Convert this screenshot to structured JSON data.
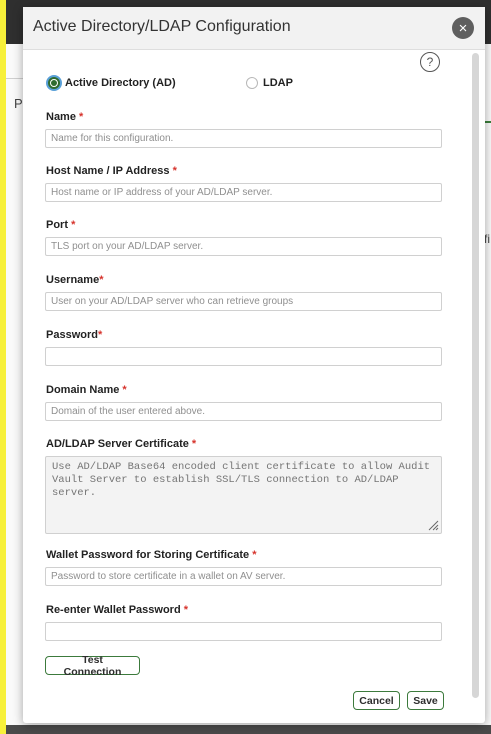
{
  "backdrop": {
    "left_letter": "P",
    "right_letters": "fi"
  },
  "dialog": {
    "title": "Active Directory/LDAP Configuration",
    "close_icon": "×",
    "help_icon": "?",
    "radios": [
      {
        "label": "Active Directory (AD)",
        "checked": true
      },
      {
        "label": "LDAP",
        "checked": false
      }
    ],
    "required_mark": "*",
    "fields": {
      "name": {
        "label": "Name",
        "placeholder": "Name for this configuration."
      },
      "host": {
        "label": "Host Name / IP Address",
        "placeholder": "Host name or IP address of your AD/LDAP server."
      },
      "port": {
        "label": "Port",
        "placeholder": "TLS port on your AD/LDAP server."
      },
      "username": {
        "label": "Username",
        "placeholder": "User on your AD/LDAP server who can retrieve groups"
      },
      "password": {
        "label": "Password",
        "placeholder": ""
      },
      "domain": {
        "label": "Domain Name",
        "placeholder": "Domain of the user entered above."
      },
      "certificate": {
        "label": "AD/LDAP Server Certificate",
        "placeholder": "Use AD/LDAP Base64 encoded client certificate to allow Audit Vault Server to establish SSL/TLS connection to AD/LDAP server."
      },
      "wallet_password": {
        "label": "Wallet Password for Storing Certificate",
        "placeholder": "Password to store certificate in a wallet on AV server."
      },
      "wallet_reenter": {
        "label": "Re-enter Wallet Password",
        "placeholder": ""
      }
    },
    "buttons": {
      "test": "Test Connection",
      "cancel": "Cancel",
      "save": "Save"
    },
    "colors": {
      "accent_green": "#3c7a3c",
      "required_red": "#d6322b",
      "focus_blue": "#5aa0d8"
    }
  }
}
